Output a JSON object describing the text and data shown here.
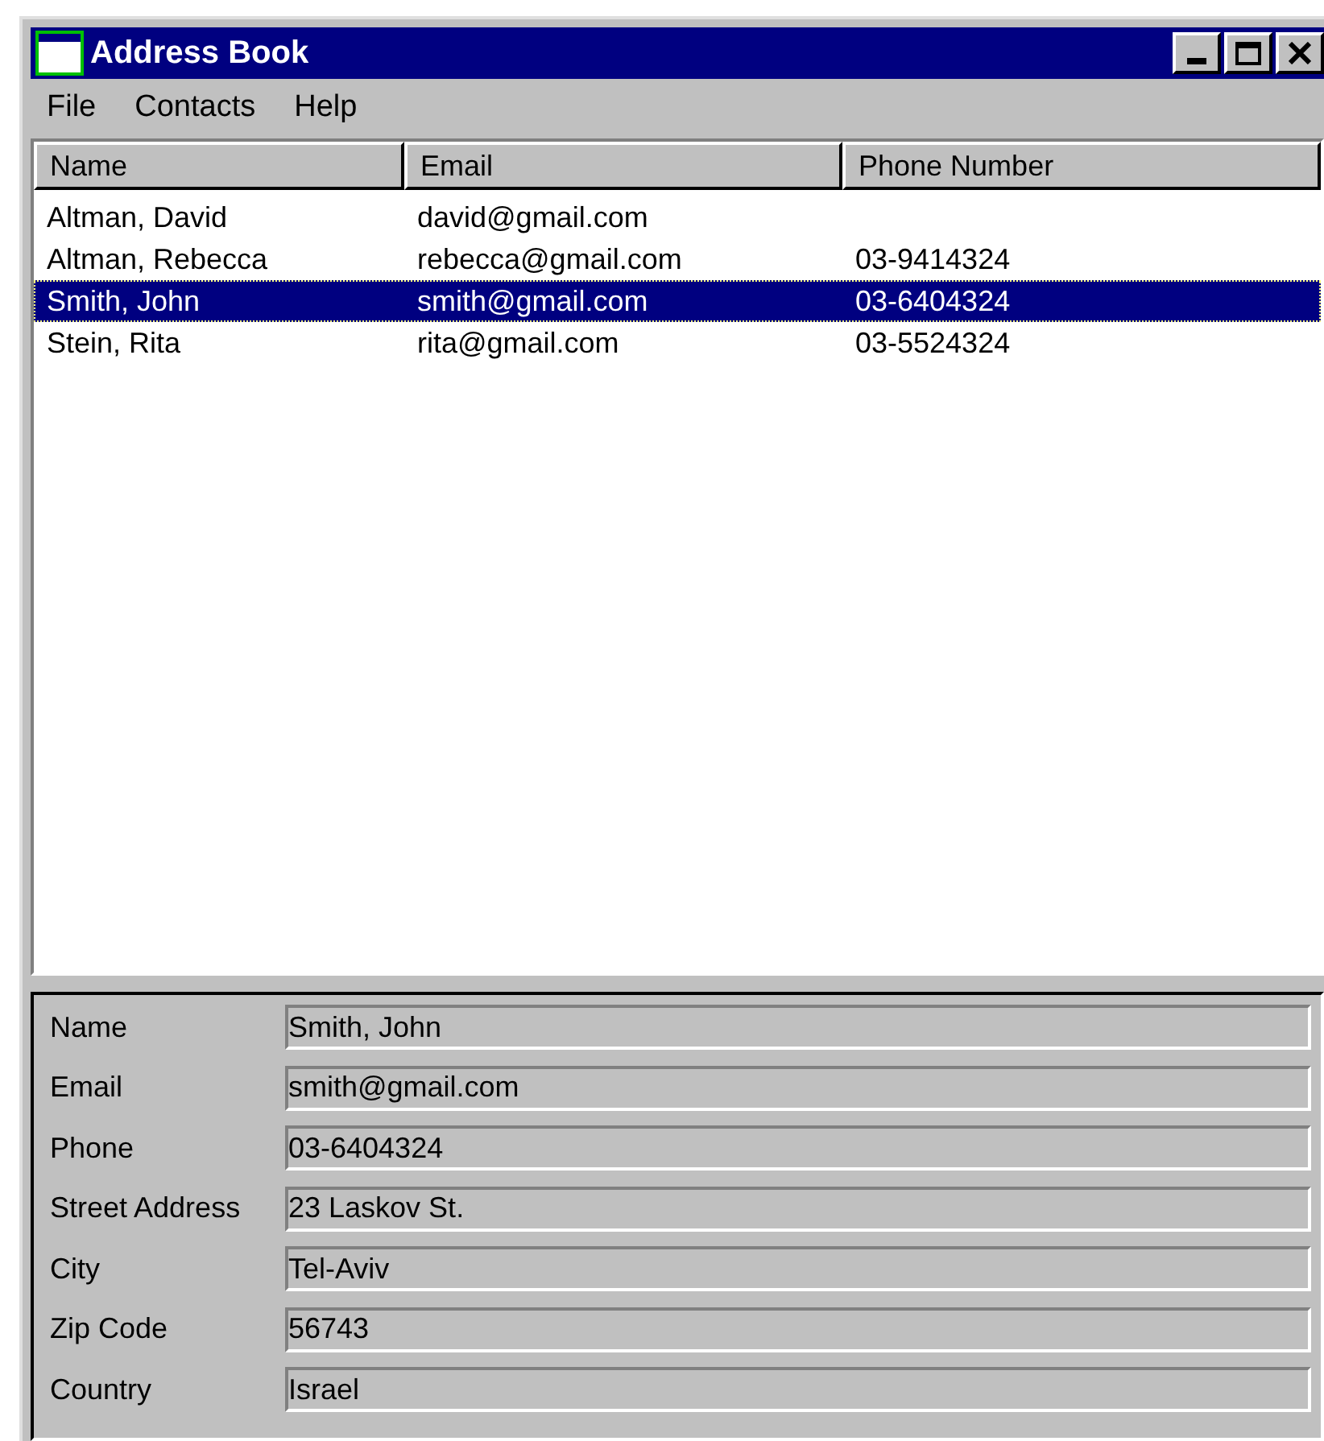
{
  "window": {
    "title": "Address Book"
  },
  "menu": [
    "File",
    "Contacts",
    "Help"
  ],
  "table": {
    "columns": [
      "Name",
      "Email",
      "Phone Number"
    ],
    "rows": [
      {
        "cells": [
          "Altman, David",
          "david@gmail.com",
          ""
        ],
        "selected": false
      },
      {
        "cells": [
          "Altman, Rebecca",
          "rebecca@gmail.com",
          "03-9414324"
        ],
        "selected": false
      },
      {
        "cells": [
          "Smith, John",
          "smith@gmail.com",
          "03-6404324"
        ],
        "selected": true
      },
      {
        "cells": [
          "Stein, Rita",
          "rita@gmail.com",
          "03-5524324"
        ],
        "selected": false
      }
    ]
  },
  "details": [
    {
      "label": "Name",
      "value": "Smith, John"
    },
    {
      "label": "Email",
      "value": "smith@gmail.com"
    },
    {
      "label": "Phone",
      "value": "03-6404324"
    },
    {
      "label": "Street Address",
      "value": "23 Laskov St."
    },
    {
      "label": "City",
      "value": "Tel-Aviv"
    },
    {
      "label": "Zip Code",
      "value": "56743"
    },
    {
      "label": "Country",
      "value": "Israel"
    }
  ]
}
